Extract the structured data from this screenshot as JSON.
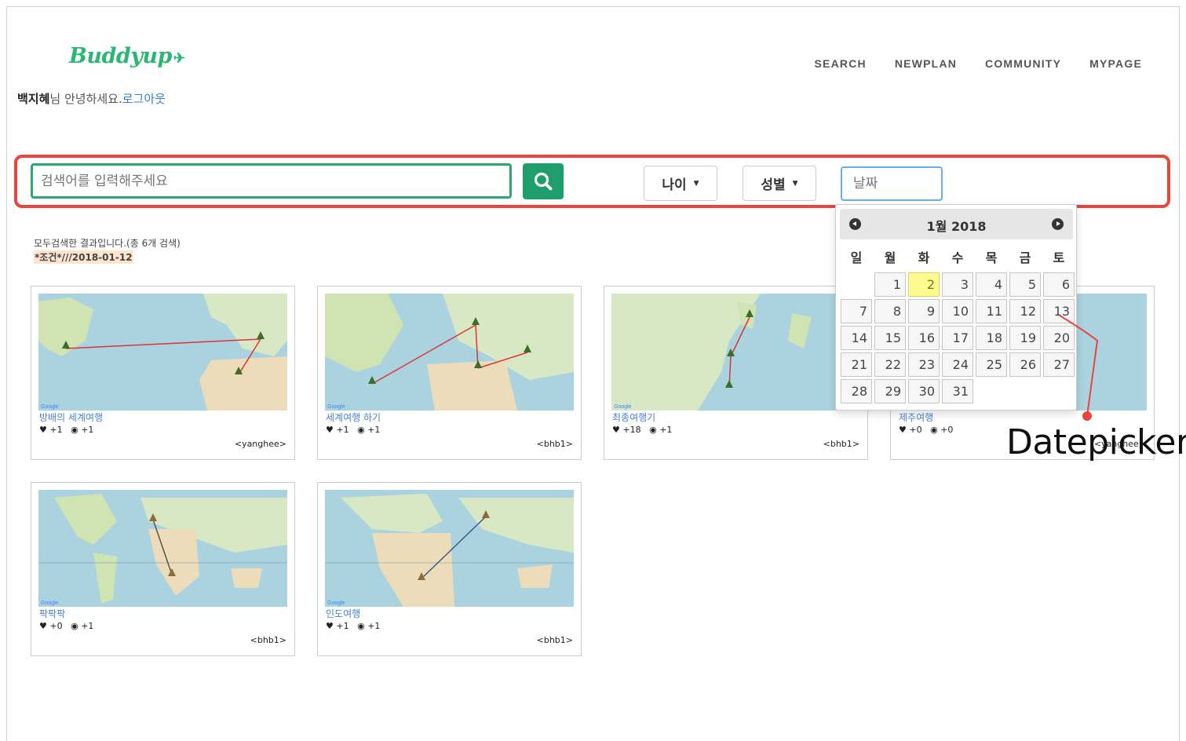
{
  "brand": {
    "logo_text": "Buddyup",
    "logo_plane": "✈"
  },
  "nav": {
    "items": [
      "SEARCH",
      "NEWPLAN",
      "COMMUNITY",
      "MYPAGE"
    ]
  },
  "greeting": {
    "name": "백지혜",
    "suffix": "님 안녕하세요.",
    "logout": "로그아웃"
  },
  "search": {
    "placeholder": "검색어를 입력해주세요",
    "age_label": "나이",
    "gender_label": "성별",
    "date_placeholder": "날짜"
  },
  "results": {
    "summary": "모두검색한 결과입니다.(총 6개 검색)",
    "condition": "*조건*///2018-01-12"
  },
  "cards": [
    {
      "title": "방배의 세계여행",
      "likes": "+1",
      "views": "+1",
      "user": "<yanghee>"
    },
    {
      "title": "세계여행 하기",
      "likes": "+1",
      "views": "+1",
      "user": "<bhb1>"
    },
    {
      "title": "최종여행기",
      "likes": "+18",
      "views": "+1",
      "user": "<bhb1>"
    },
    {
      "title": "제주여행",
      "likes": "+0",
      "views": "+0",
      "user": "<yanghee>"
    },
    {
      "title": "팍팍팍",
      "likes": "+0",
      "views": "+1",
      "user": "<bhb1>"
    },
    {
      "title": "인도여행",
      "likes": "+1",
      "views": "+1",
      "user": "<bhb1>"
    }
  ],
  "datepicker": {
    "title": "1월 2018",
    "weekdays": [
      "일",
      "월",
      "화",
      "수",
      "목",
      "금",
      "토"
    ],
    "days": [
      1,
      2,
      3,
      4,
      5,
      6,
      7,
      8,
      9,
      10,
      11,
      12,
      13,
      14,
      15,
      16,
      17,
      18,
      19,
      20,
      21,
      22,
      23,
      24,
      25,
      26,
      27,
      28,
      29,
      30,
      31
    ],
    "highlighted_day": 2,
    "highlight_color": "#fffa90"
  },
  "annotation": {
    "label": "Datepicker",
    "color": "#e8453c"
  },
  "colors": {
    "brand_green": "#2bb673",
    "search_button": "#1e9e6c",
    "highlight_box": "#e8453c",
    "link_blue": "#4a7fd4"
  }
}
